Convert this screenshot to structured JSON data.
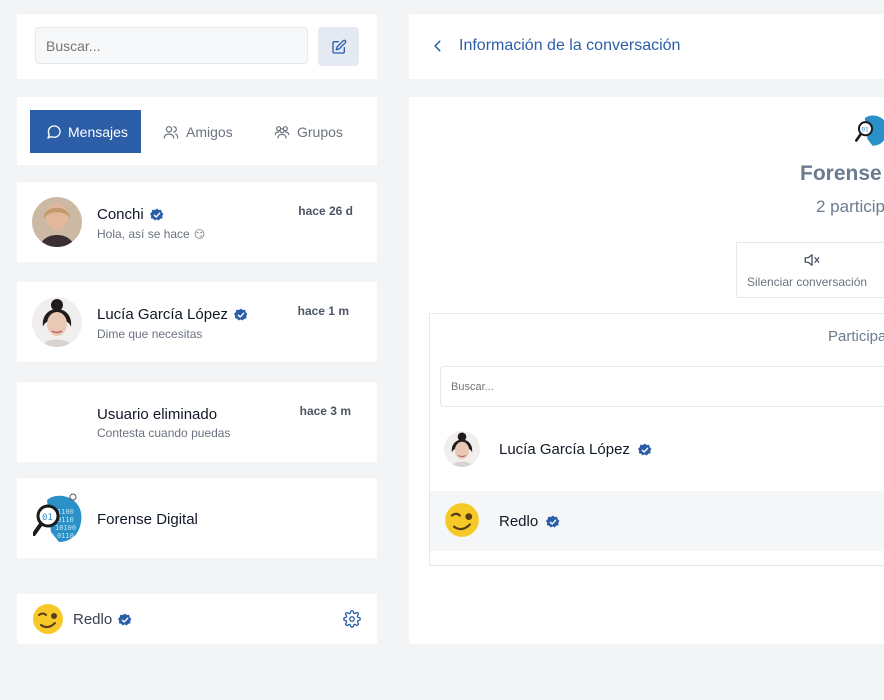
{
  "sidebar": {
    "search_placeholder": "Buscar...",
    "compose_icon": "pencil-square-icon",
    "tabs": [
      {
        "label": "Mensajes",
        "icon": "chat-bubbles-icon",
        "active": true
      },
      {
        "label": "Amigos",
        "icon": "users-icon",
        "active": false
      },
      {
        "label": "Grupos",
        "icon": "user-group-icon",
        "active": false
      }
    ],
    "chats": [
      {
        "name": "Conchi",
        "verified": true,
        "preview": "Hola, así se hace",
        "preview_emoji": "😏",
        "time": "hace 26 d"
      },
      {
        "name": "Lucía García López",
        "verified": true,
        "preview": "Dime que necesitas",
        "time": "hace 1 m"
      },
      {
        "name": "Usuario eliminado",
        "verified": false,
        "preview": "Contesta cuando puedas",
        "time": "hace 3 m"
      },
      {
        "name": "Forense Digital",
        "verified": false,
        "preview": "",
        "time": ""
      }
    ],
    "current_user": {
      "name": "Redlo",
      "verified": true,
      "settings_icon": "gear-icon"
    }
  },
  "conversation": {
    "back_icon": "chevron-left-icon",
    "title": "Información de la conversación",
    "group_name": "Forense D",
    "participant_count": "2 particip",
    "mute_label": "Silenciar conversación",
    "mute_icon": "speaker-mute-icon",
    "participants_title": "Participa",
    "participants_search_placeholder": "Buscar...",
    "participants": [
      {
        "name": "Lucía García López",
        "verified": true
      },
      {
        "name": "Redlo",
        "verified": true
      }
    ]
  },
  "colors": {
    "accent": "#2c5ea8",
    "verified_badge": "#2c5ea8",
    "background": "#f3f4f6"
  }
}
